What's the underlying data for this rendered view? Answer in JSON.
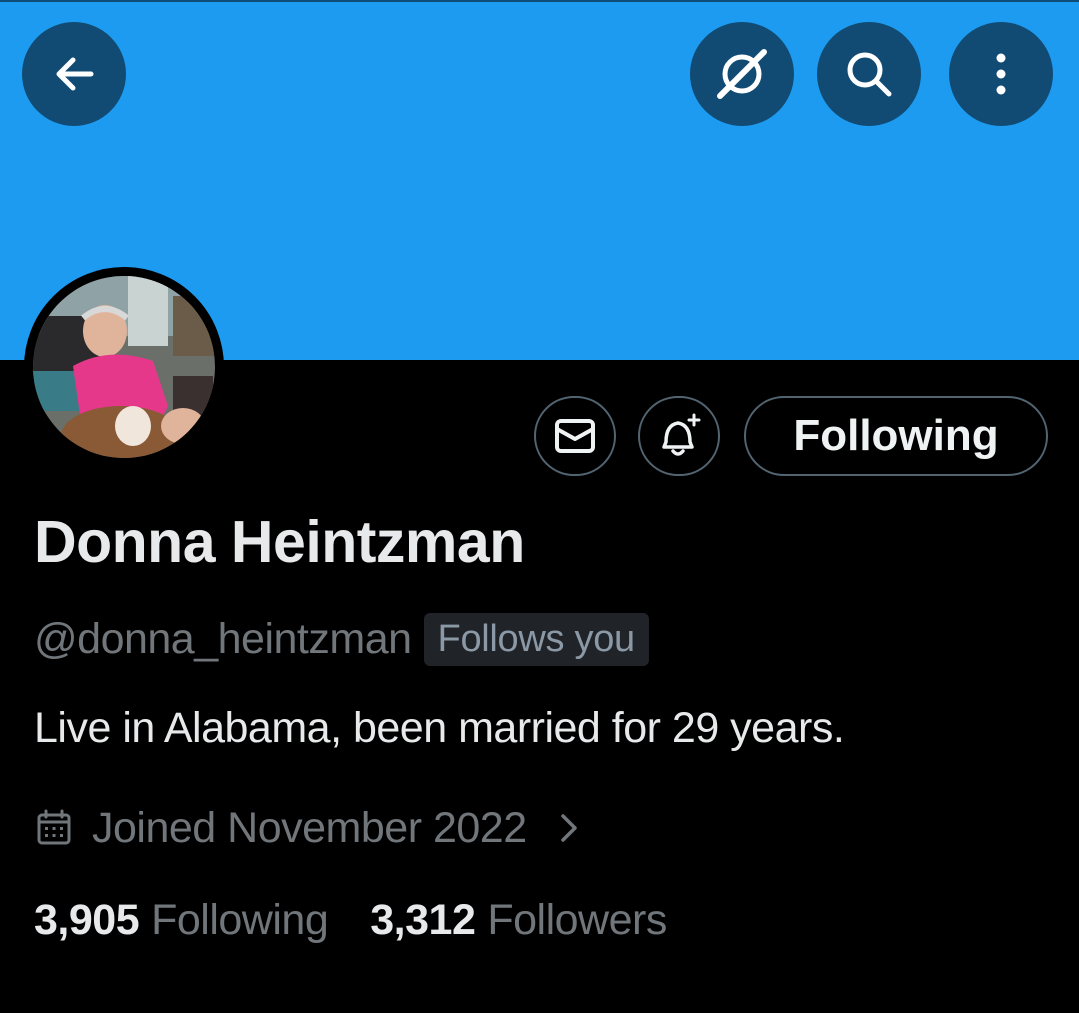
{
  "header": {
    "banner_color": "#1d9bf0",
    "buttons": [
      {
        "icon": "back-arrow-icon"
      },
      {
        "icon": "grok-icon"
      },
      {
        "icon": "search-icon"
      },
      {
        "icon": "more-vertical-icon"
      }
    ]
  },
  "profile": {
    "display_name": "Donna Heintzman",
    "handle": "@donna_heintzman",
    "follows_you": "Follows you",
    "bio": "Live in Alabama, been married for 29 years.",
    "joined": "Joined November 2022",
    "following_count": "3,905",
    "following_label": "Following",
    "followers_count": "3,312",
    "followers_label": "Followers"
  },
  "actions": {
    "message_icon": "envelope-icon",
    "notify_icon": "bell-plus-icon",
    "follow_state": "Following"
  }
}
